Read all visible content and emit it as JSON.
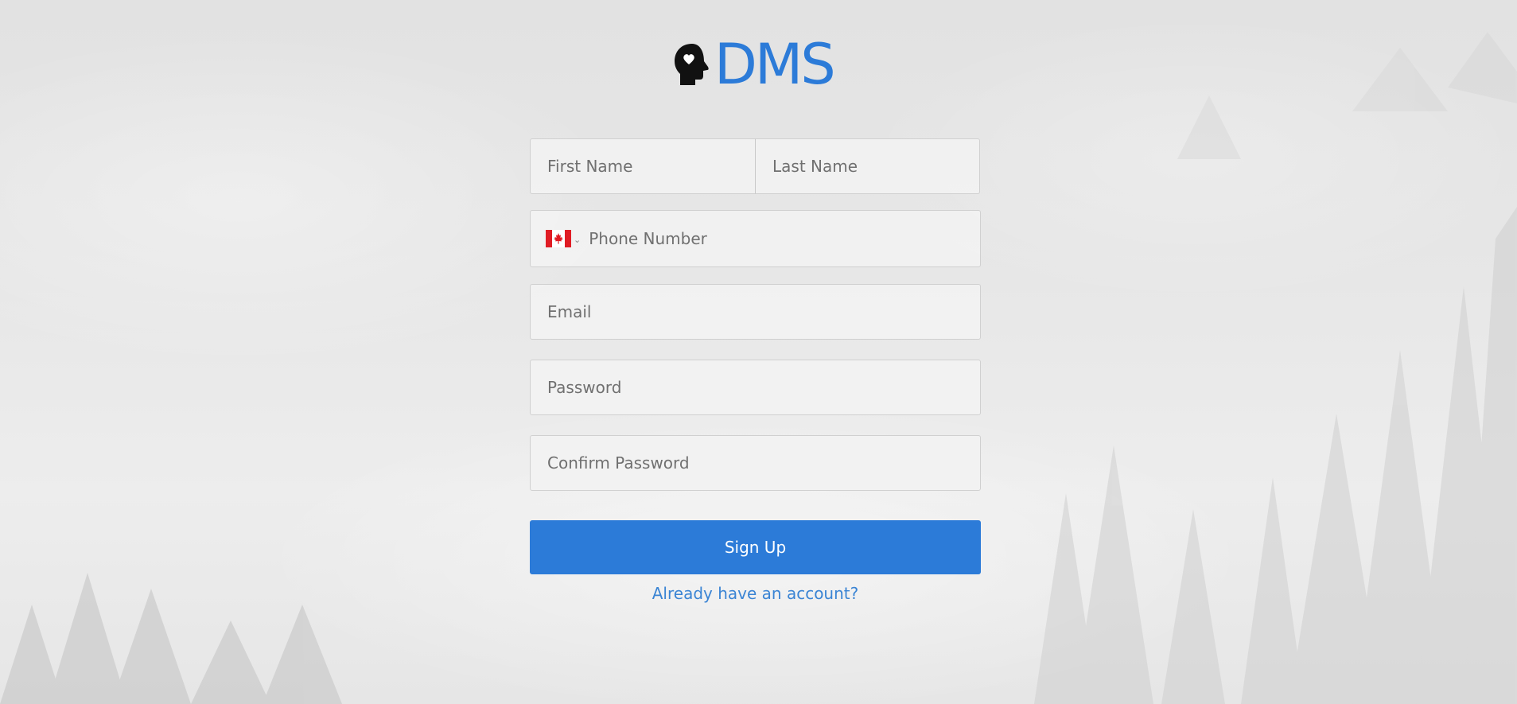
{
  "brand": {
    "name": "DMS",
    "color": "#2c7bd8",
    "icon": "head-heart-icon"
  },
  "form": {
    "first_name": {
      "placeholder": "First Name",
      "value": ""
    },
    "last_name": {
      "placeholder": "Last Name",
      "value": ""
    },
    "phone": {
      "placeholder": "Phone Number",
      "value": "",
      "country_icon": "canada-flag-icon"
    },
    "email": {
      "placeholder": "Email",
      "value": ""
    },
    "password": {
      "placeholder": "Password",
      "value": ""
    },
    "confirm_password": {
      "placeholder": "Confirm Password",
      "value": ""
    },
    "submit_label": "Sign Up",
    "submit_color": "#2c7bd8",
    "login_link": "Already have an account?"
  }
}
